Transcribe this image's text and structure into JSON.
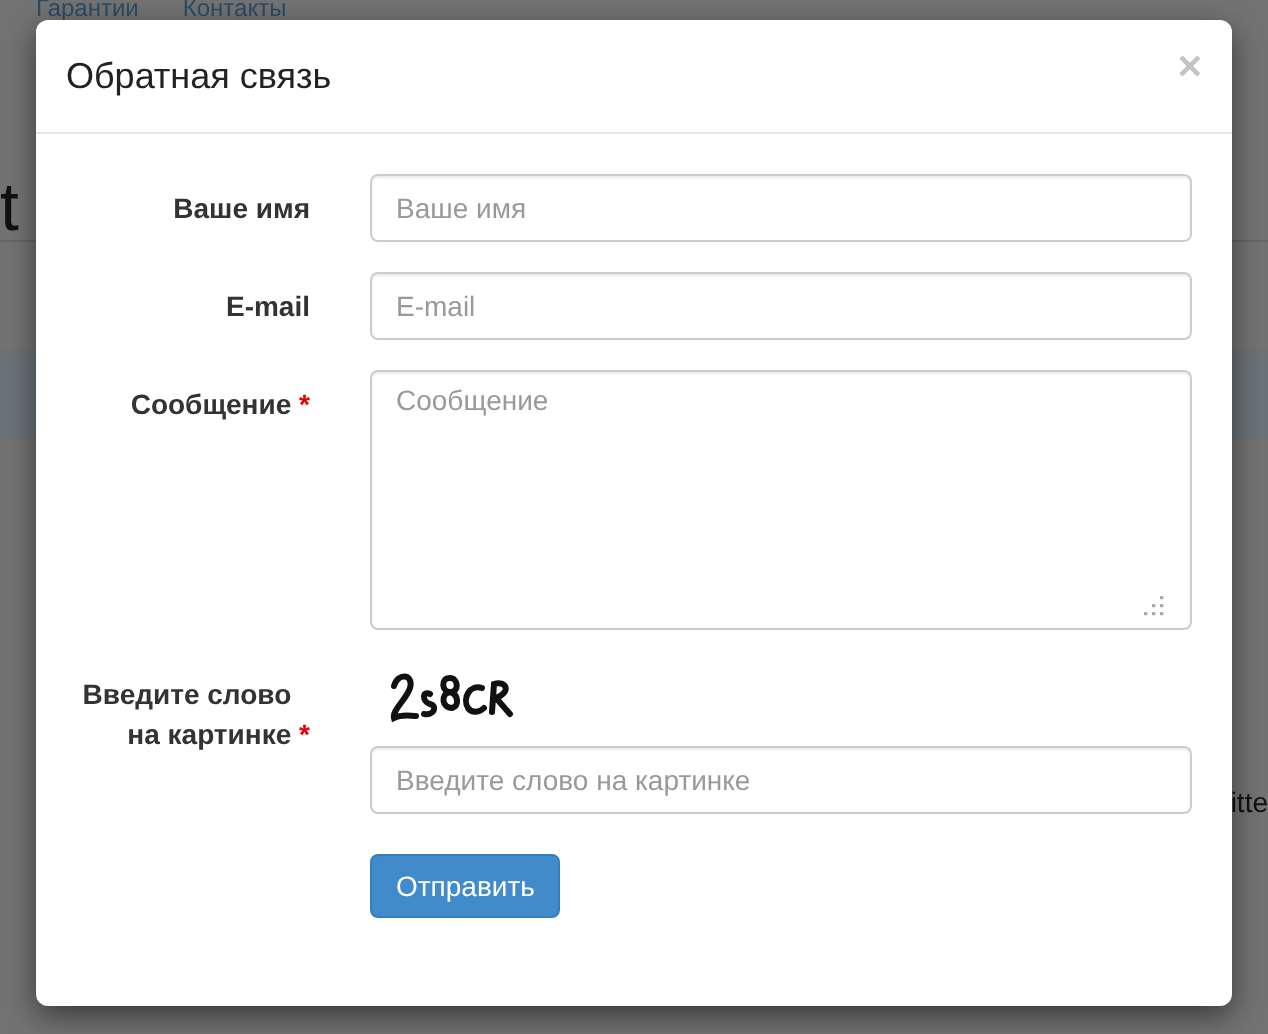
{
  "background_page": {
    "nav_links": [
      "Гарантии",
      "Контакты"
    ],
    "heading_fragment": "t",
    "text_fragment": "itte"
  },
  "modal": {
    "title": "Обратная связь",
    "close": "×",
    "fields": [
      {
        "kind": "input",
        "label": "Ваше имя",
        "placeholder": "Ваше имя"
      },
      {
        "kind": "input",
        "label": "E-mail",
        "placeholder": "E-mail"
      },
      {
        "kind": "textarea",
        "label": "Сообщение",
        "required_mark": "*",
        "placeholder": "Сообщение"
      },
      {
        "kind": "captcha",
        "label": "Введите слово на картинке",
        "required_mark": "*",
        "placeholder": "Введите слово на картинке"
      }
    ],
    "submit": "Отправить"
  }
}
